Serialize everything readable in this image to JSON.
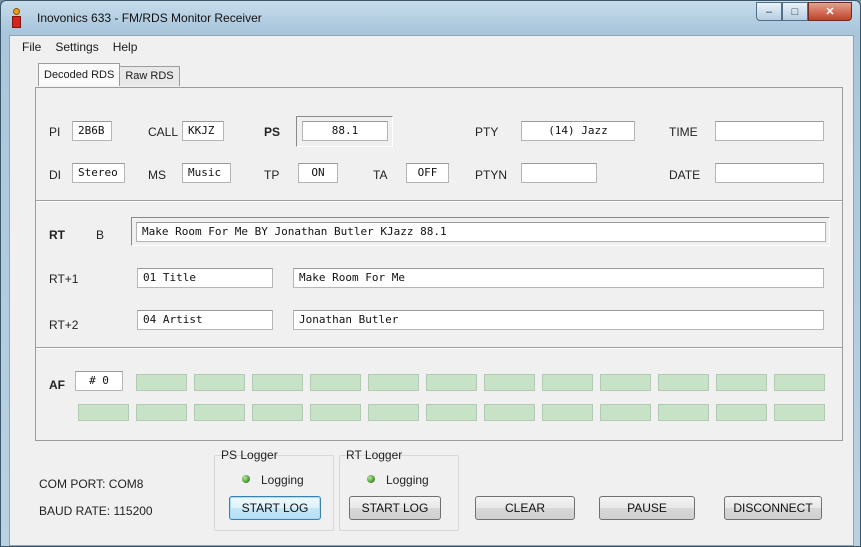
{
  "window": {
    "title": "Inovonics 633 - FM/RDS Monitor Receiver",
    "controls": {
      "minimize": "‒",
      "maximize": "□",
      "close": "✕"
    }
  },
  "menu": [
    "File",
    "Settings",
    "Help"
  ],
  "tabs": [
    {
      "label": "Decoded RDS",
      "active": true
    },
    {
      "label": "Raw RDS",
      "active": false
    }
  ],
  "decoded": {
    "pi": {
      "label": "PI",
      "value": "2B6B"
    },
    "call": {
      "label": "CALL",
      "value": "KKJZ"
    },
    "ps": {
      "label": "PS",
      "value": "88.1"
    },
    "pty": {
      "label": "PTY",
      "value": "(14) Jazz"
    },
    "time": {
      "label": "TIME",
      "value": ""
    },
    "di": {
      "label": "DI",
      "value": "Stereo"
    },
    "ms": {
      "label": "MS",
      "value": "Music"
    },
    "tp": {
      "label": "TP",
      "value": "ON"
    },
    "ta": {
      "label": "TA",
      "value": "OFF"
    },
    "ptyn": {
      "label": "PTYN",
      "value": ""
    },
    "date": {
      "label": "DATE",
      "value": ""
    }
  },
  "radiotext": {
    "rt": {
      "label": "RT",
      "ab": "B",
      "value": "Make Room For Me BY Jonathan Butler KJazz 88.1"
    },
    "rt1": {
      "label": "RT+1",
      "tag": "01 Title",
      "value": "Make Room For Me"
    },
    "rt2": {
      "label": "RT+2",
      "tag": "04 Artist",
      "value": "Jonathan Butler"
    }
  },
  "af": {
    "label": "AF",
    "count": "# 0",
    "slots_row1": 12,
    "slots_row2": 13
  },
  "status": {
    "com_port": "COM PORT: COM8",
    "baud_rate": "BAUD RATE: 115200"
  },
  "ps_logger": {
    "title": "PS Logger",
    "status": "Logging",
    "button": "START LOG"
  },
  "rt_logger": {
    "title": "RT Logger",
    "status": "Logging",
    "button": "START LOG"
  },
  "buttons": {
    "clear": "CLEAR",
    "pause": "PAUSE",
    "disconnect": "DISCONNECT"
  },
  "colors": {
    "af_slot": "#c7e2c7",
    "led": "#4f9b38",
    "window_frame": "#a9c6dc"
  }
}
